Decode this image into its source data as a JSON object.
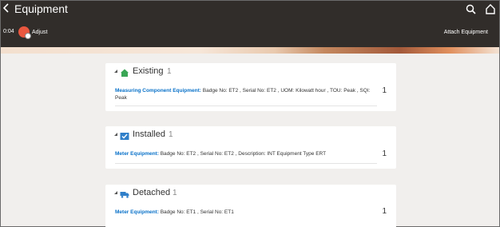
{
  "header": {
    "title": "Equipment",
    "time": "0:04",
    "adjust_label": "Adjust",
    "attach_label": "Attach Equipment"
  },
  "sections": [
    {
      "title": "Existing",
      "count": "1",
      "icon": "home-icon",
      "row": {
        "link": "Measuring Component Equipment:",
        "details": " Badge No: ET2 , Serial No: ET2 , UOM: Kilowatt hour , TOU: Peak , SQI: Peak",
        "count": "1"
      }
    },
    {
      "title": "Installed",
      "count": "1",
      "icon": "calendar-check-icon",
      "row": {
        "link": "Meter Equipment:",
        "details": " Badge No: ET2 , Serial No: ET2 , Description: INT Equipment Type ERT",
        "count": "1"
      }
    },
    {
      "title": "Detached",
      "count": "1",
      "icon": "truck-icon",
      "row": {
        "link": "Meter Equipment:",
        "details": " Badge No: ET1 , Serial No: ET1",
        "count": "1"
      }
    }
  ],
  "colors": {
    "header_bg": "#312d2a",
    "link": "#0a72c9",
    "icon_green": "#3aa655",
    "icon_blue": "#2f7fc9"
  }
}
